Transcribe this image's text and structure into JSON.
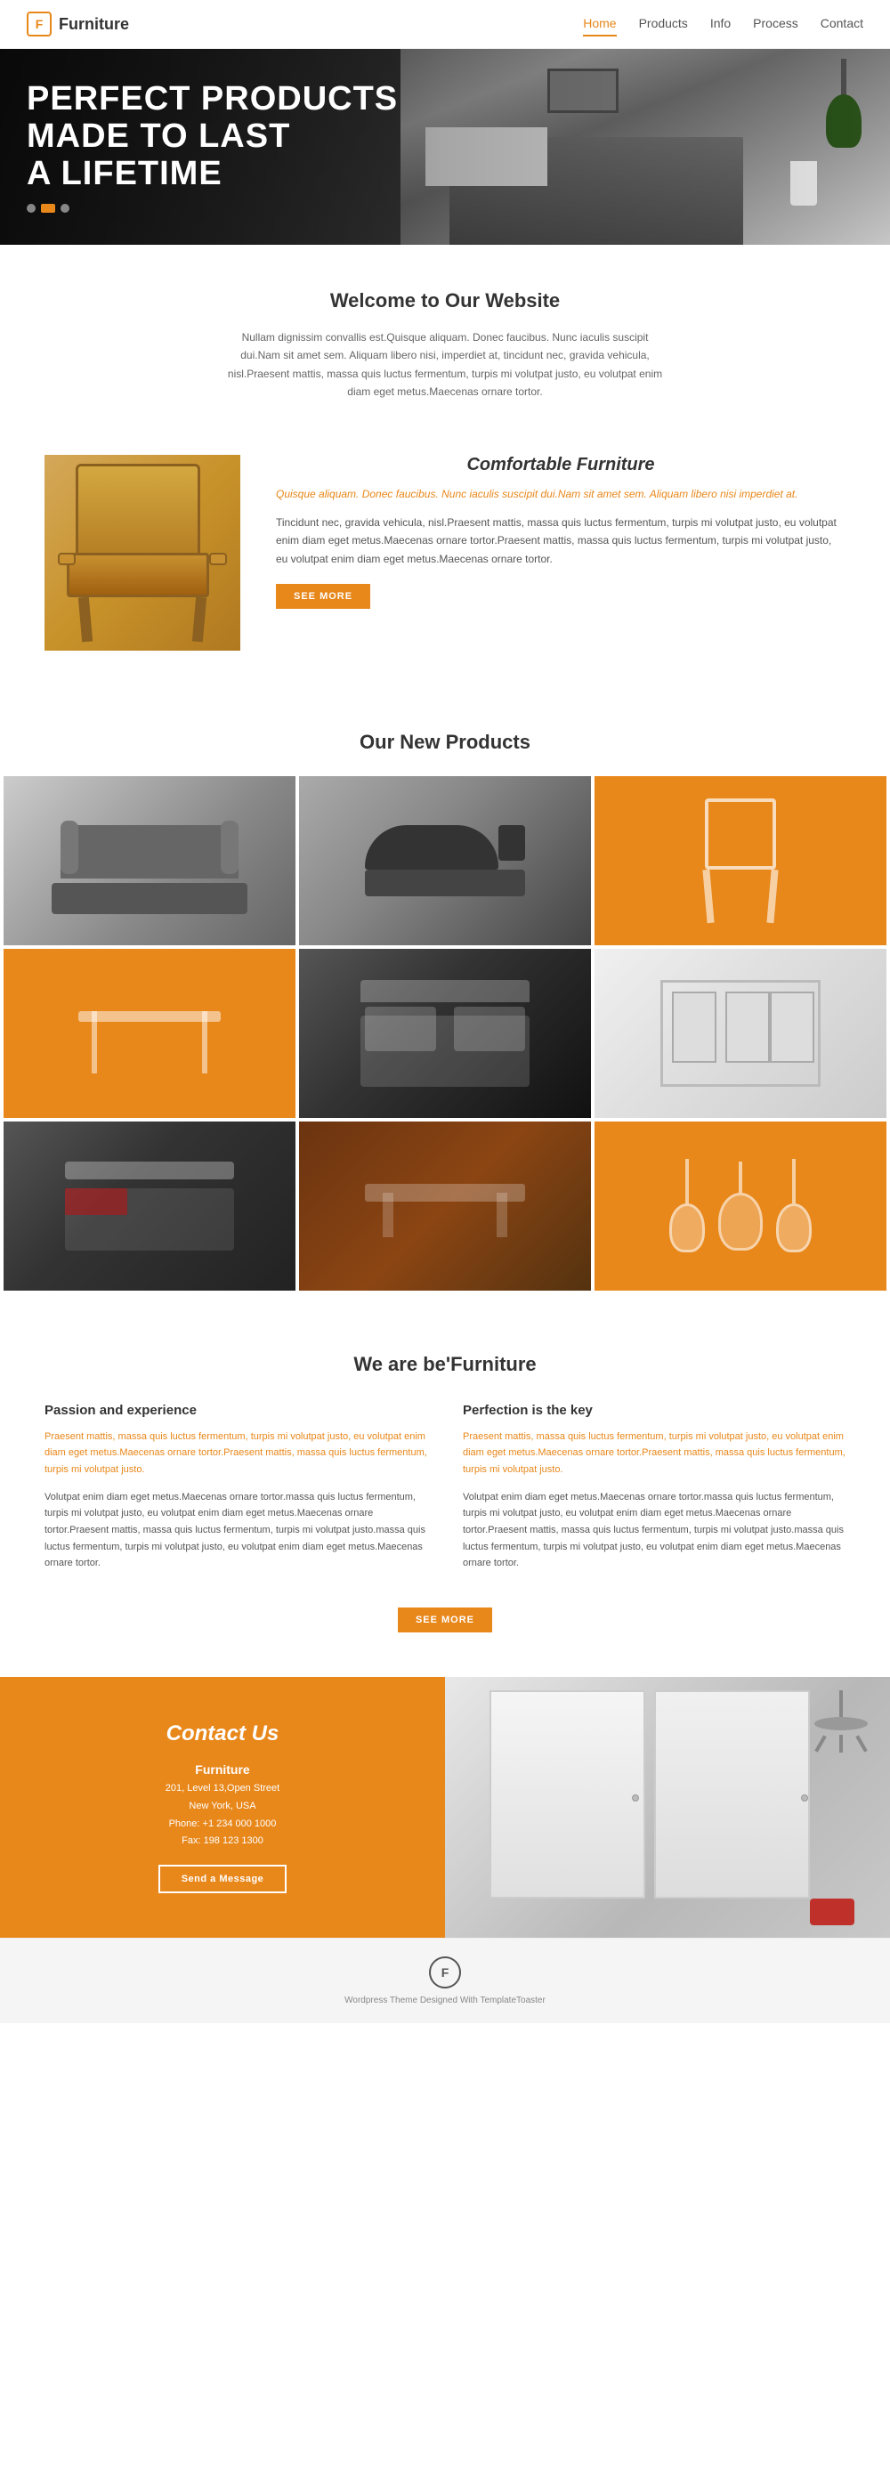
{
  "header": {
    "logo_letter": "F",
    "logo_text": "Furniture",
    "nav": [
      {
        "label": "Home",
        "active": true
      },
      {
        "label": "Products",
        "active": false
      },
      {
        "label": "Info",
        "active": false
      },
      {
        "label": "Process",
        "active": false
      },
      {
        "label": "Contact",
        "active": false
      }
    ]
  },
  "hero": {
    "line1": "PERFECT PRODUCTS",
    "line2": "MADE TO LAST",
    "line3": "A LIFETIME"
  },
  "welcome": {
    "title": "Welcome to Our Website",
    "body": "Nullam dignissim convallis est.Quisque aliquam. Donec faucibus. Nunc iaculis suscipit dui.Nam sit amet sem. Aliquam libero nisi, imperdiet at, tincidunt nec, gravida vehicula, nisl.Praesent mattis, massa quis luctus fermentum, turpis mi volutpat justo, eu volutpat enim diam eget metus.Maecenas ornare tortor."
  },
  "comfortable": {
    "title": "Comfortable Furniture",
    "highlight": "Quisque aliquam. Donec faucibus. Nunc iaculis suscipit dui.Nam sit amet sem. Aliquam libero nisi imperdiet at.",
    "body": "Tincidunt nec, gravida vehicula, nisl.Praesent mattis, massa quis luctus fermentum, turpis mi volutpat justo, eu volutpat enim diam eget metus.Maecenas ornare tortor.Praesent mattis, massa quis luctus fermentum, turpis mi volutpat justo, eu volutpat enim diam eget metus.Maecenas ornare tortor.",
    "btn_label": "SEE MORE"
  },
  "products": {
    "title": "Our New Products",
    "items": [
      {
        "id": "sofa",
        "type": "sofa"
      },
      {
        "id": "lounge-chair",
        "type": "lounge"
      },
      {
        "id": "wood-chair",
        "type": "orange"
      },
      {
        "id": "console-table",
        "type": "orange"
      },
      {
        "id": "bedroom",
        "type": "bedroom"
      },
      {
        "id": "white-room",
        "type": "white"
      },
      {
        "id": "dark-bed",
        "type": "dark-bed"
      },
      {
        "id": "coffee-table",
        "type": "coffee"
      },
      {
        "id": "pendant",
        "type": "orange"
      }
    ]
  },
  "we_are": {
    "title": "We are be'Furniture",
    "col1": {
      "heading": "Passion and experience",
      "highlight": "Praesent mattis, massa quis luctus fermentum, turpis mi volutpat justo, eu volutpat enim diam eget metus.Maecenas ornare tortor.Praesent mattis, massa quis luctus fermentum, turpis mi volutpat justo.",
      "body": "Volutpat enim diam eget metus.Maecenas ornare tortor.massa quis luctus fermentum, turpis mi volutpat justo, eu volutpat enim diam eget metus.Maecenas ornare tortor.Praesent mattis, massa quis luctus fermentum, turpis mi volutpat justo.massa quis luctus fermentum, turpis mi volutpat justo, eu volutpat enim diam eget metus.Maecenas ornare tortor."
    },
    "col2": {
      "heading": "Perfection is the key",
      "highlight": "Praesent mattis, massa quis luctus fermentum, turpis mi volutpat justo, eu volutpat enim diam eget metus.Maecenas ornare tortor.Praesent mattis, massa quis luctus fermentum, turpis mi volutpat justo.",
      "body": "Volutpat enim diam eget metus.Maecenas ornare tortor.massa quis luctus fermentum, turpis mi volutpat justo, eu volutpat enim diam eget metus.Maecenas ornare tortor.Praesent mattis, massa quis luctus fermentum, turpis mi volutpat justo.massa quis luctus fermentum, turpis mi volutpat justo, eu volutpat enim diam eget metus.Maecenas ornare tortor."
    },
    "btn_label": "SEE MORE"
  },
  "contact": {
    "title": "Contact Us",
    "company": "Furniture",
    "address_line1": "201, Level 13,Open Street",
    "address_line2": "New York, USA",
    "phone": "Phone: +1 234 000 1000",
    "fax": "Fax: 198 123 1300",
    "btn_label": "Send a Message"
  },
  "footer": {
    "logo_letter": "F",
    "text": "Wordpress Theme Designed With TemplateToaster"
  }
}
